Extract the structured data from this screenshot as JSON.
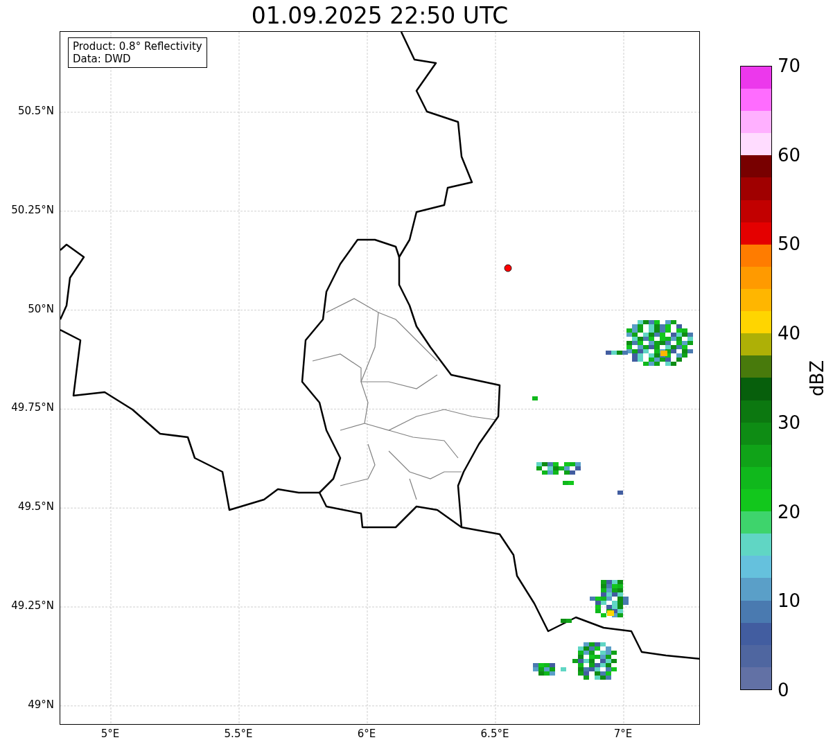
{
  "title": "01.09.2025 22:50 UTC",
  "info_box": {
    "lines": [
      "Product: 0.8° Reflectivity",
      "Data: DWD"
    ]
  },
  "map": {
    "lat_ticks": [
      "50.5°N",
      "50.25°N",
      "50°N",
      "49.75°N",
      "49.5°N",
      "49.25°N",
      "49°N"
    ],
    "lon_ticks": [
      "5°E",
      "5.5°E",
      "6°E",
      "6.5°E",
      "7°E"
    ]
  },
  "colorbar": {
    "label": "dBZ",
    "ticks": [
      "70",
      "60",
      "50",
      "40",
      "30",
      "20",
      "10",
      "0"
    ],
    "bins": [
      {
        "color": "#6271a5"
      },
      {
        "color": "#4f66a0"
      },
      {
        "color": "#425da0"
      },
      {
        "color": "#4a7ab0"
      },
      {
        "color": "#5a9fc8"
      },
      {
        "color": "#65c1dd"
      },
      {
        "color": "#60d6c4"
      },
      {
        "color": "#3ed46c"
      },
      {
        "color": "#12c71c"
      },
      {
        "color": "#10b81c"
      },
      {
        "color": "#10a318"
      },
      {
        "color": "#0e8c14"
      },
      {
        "color": "#0c7810"
      },
      {
        "color": "#075f0c"
      },
      {
        "color": "#487a0c"
      },
      {
        "color": "#aeb006"
      },
      {
        "color": "#ffd500"
      },
      {
        "color": "#ffb600"
      },
      {
        "color": "#ff9a00"
      },
      {
        "color": "#ff7c00"
      },
      {
        "color": "#e40000"
      },
      {
        "color": "#c20000"
      },
      {
        "color": "#a00000"
      },
      {
        "color": "#780000"
      },
      {
        "color": "#ffdcff"
      },
      {
        "color": "#ffb0ff"
      },
      {
        "color": "#ff6cff"
      },
      {
        "color": "#ec38ec"
      }
    ]
  }
}
